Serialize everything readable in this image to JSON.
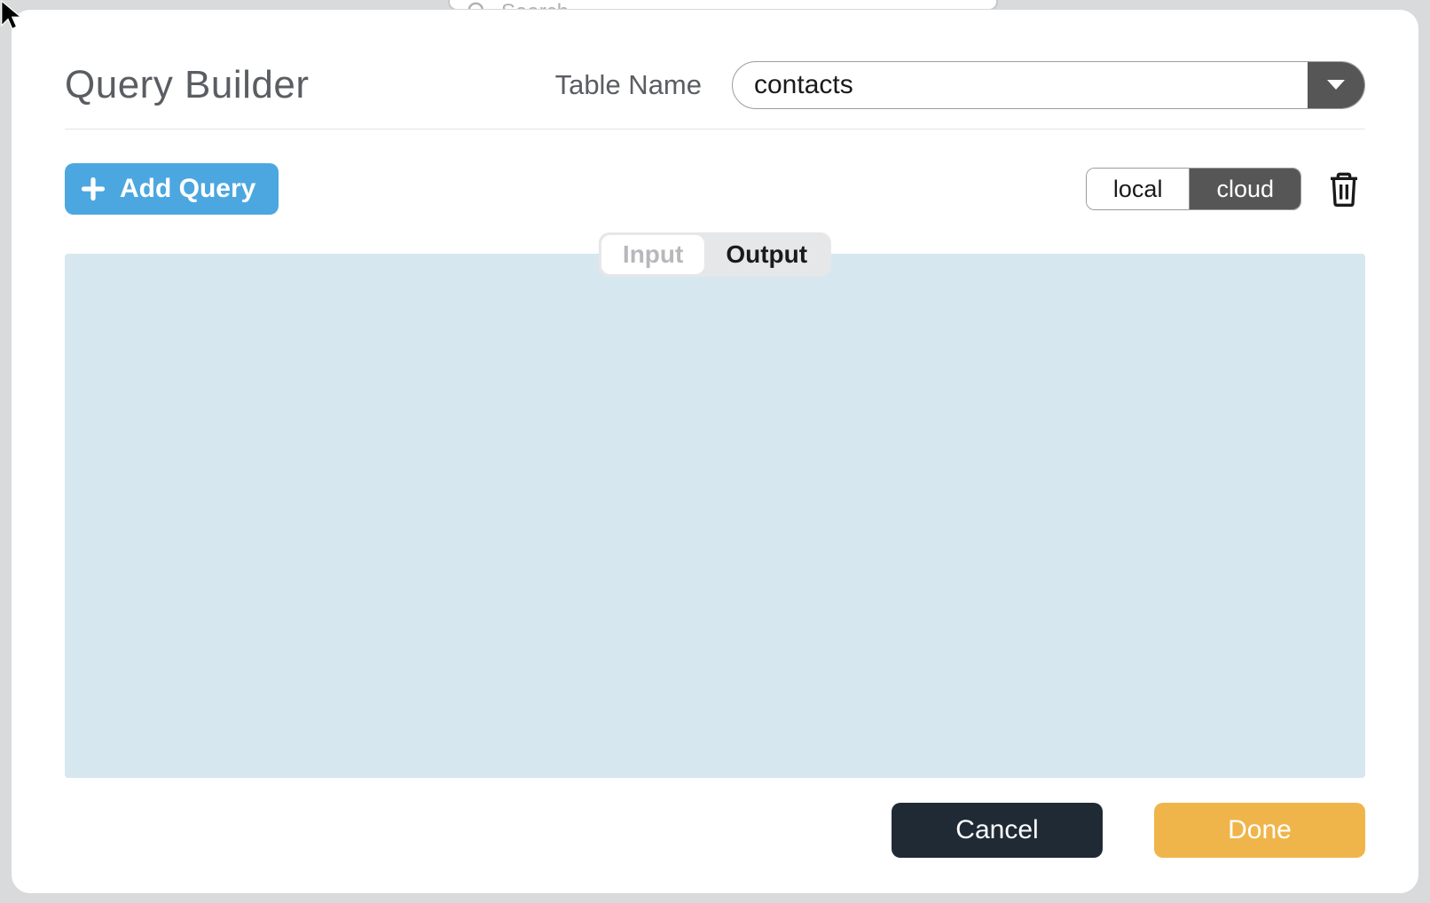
{
  "background": {
    "search_placeholder": "Search"
  },
  "title": "Query Builder",
  "table": {
    "label": "Table Name",
    "value": "contacts"
  },
  "toolbar": {
    "add_query_label": "Add Query",
    "scope": {
      "local": "local",
      "cloud": "cloud",
      "active": "cloud"
    }
  },
  "io_tabs": {
    "input": "Input",
    "output": "Output",
    "active": "output"
  },
  "footer": {
    "cancel": "Cancel",
    "done": "Done"
  }
}
